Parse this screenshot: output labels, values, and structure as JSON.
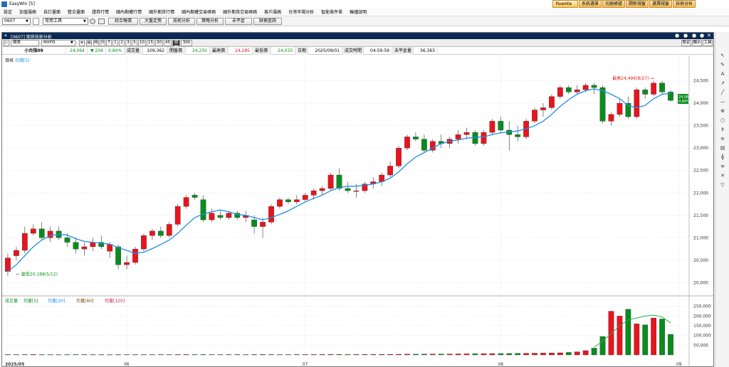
{
  "window": {
    "title": "EasyWin [5]"
  },
  "quickbar": {
    "logo": "Yuanta",
    "buttons": [
      "系統選單",
      "切換帳號",
      "開新視窗",
      "選擇視窗",
      "技術分析"
    ]
  },
  "menu": [
    "設定",
    "加值服務",
    "自訂畫面",
    "整合畫面",
    "證券行情",
    "國內期權行情",
    "國外期貨行情",
    "國內期權交易帳務",
    "國外期貨交易帳務",
    "客戶服務",
    "台灣市場分析",
    "智能條件單",
    "輪播說明"
  ],
  "toolbar": {
    "code": "0607",
    "dropdown": "常用工具",
    "buttons": [
      "綜合報價",
      "大盤走勢",
      "技術分析",
      "策略分析",
      "未平倉",
      "財務查詢"
    ]
  },
  "panel": {
    "title": "[0607] 期貨技術分析",
    "product": "期貨",
    "symbol": "MXFI5",
    "periods": [
      "時",
      "分",
      "T",
      "1",
      "2",
      "3",
      "5",
      "10",
      "15",
      "30",
      "45",
      "期間",
      "300"
    ],
    "right_buttons": [
      "設定",
      "顯示",
      "工具"
    ]
  },
  "info": {
    "name": "小台指09",
    "price": "24,064",
    "change": "204",
    "change_pct": "0.84%",
    "vol_label": "成交量",
    "vol": "109,362",
    "open_label": "開盤價",
    "open": "24,250",
    "high_label": "最高價",
    "high": "24,285",
    "low_label": "最低價",
    "low": "24,033",
    "date_label": "日期",
    "date": "2025/09/01",
    "time_label": "成交時間",
    "time": "04:59:59",
    "oi_label": "未平倉量",
    "oi": "36,363"
  },
  "colors": {
    "up": "#e8141e",
    "down": "#0a8c1e",
    "ma": "#1f8ee8"
  },
  "chart_data": {
    "type": "candlestick",
    "price_legend": {
      "label": "價格",
      "ma": "均價[5]"
    },
    "volume_legend": {
      "label": "成交量",
      "ma": [
        "均量[5]",
        "均量[20]",
        "均量[60]",
        "均量[120]"
      ]
    },
    "price_axis": {
      "min": 19800,
      "max": 24700,
      "ticks": [
        "24,500",
        "24,000",
        "23,500",
        "23,000",
        "22,500",
        "22,000",
        "21,500",
        "21,000",
        "20,500",
        "20,000"
      ]
    },
    "volume_axis": {
      "min": 0,
      "max": 260000,
      "ticks": [
        "250,000",
        "200,000",
        "150,000",
        "100,000",
        "50,000"
      ]
    },
    "x_labels": [
      {
        "i": 0,
        "text": "2025/05"
      },
      {
        "i": 14,
        "text": "06"
      },
      {
        "i": 35,
        "text": "07"
      },
      {
        "i": 58,
        "text": "08"
      },
      {
        "i": 79,
        "text": "09"
      }
    ],
    "annotations": {
      "high": {
        "i": 76,
        "text": "最高24,496(8/27)"
      },
      "low": {
        "i": 1,
        "text": "最低20,188(5/12)"
      }
    },
    "last_price_tag": {
      "price": "24,064",
      "pct": "0.84%"
    },
    "candles": [
      [
        20250,
        20650,
        20150,
        20550
      ],
      [
        20600,
        20800,
        20500,
        20720
      ],
      [
        20720,
        21250,
        20650,
        21100
      ],
      [
        21100,
        21300,
        21050,
        21200
      ],
      [
        21200,
        21350,
        20950,
        21000
      ],
      [
        21000,
        21250,
        20900,
        21150
      ],
      [
        21150,
        21250,
        20950,
        21000
      ],
      [
        21000,
        21100,
        20800,
        20900
      ],
      [
        20900,
        21000,
        20650,
        20750
      ],
      [
        20750,
        20900,
        20600,
        20800
      ],
      [
        20800,
        21000,
        20700,
        20900
      ],
      [
        20900,
        21050,
        20750,
        20800
      ],
      [
        20700,
        20900,
        20550,
        20850
      ],
      [
        20800,
        20850,
        20300,
        20400
      ],
      [
        20400,
        20600,
        20300,
        20450
      ],
      [
        20450,
        20800,
        20400,
        20750
      ],
      [
        20750,
        21100,
        20700,
        21050
      ],
      [
        21050,
        21200,
        20950,
        21150
      ],
      [
        21150,
        21250,
        21000,
        21050
      ],
      [
        21050,
        21350,
        21000,
        21300
      ],
      [
        21300,
        21750,
        21250,
        21700
      ],
      [
        21700,
        21950,
        21650,
        21900
      ],
      [
        21950,
        22000,
        21850,
        21900
      ],
      [
        21850,
        21950,
        21350,
        21400
      ],
      [
        21400,
        21650,
        21350,
        21550
      ],
      [
        21500,
        21600,
        21400,
        21450
      ],
      [
        21450,
        21600,
        21400,
        21550
      ],
      [
        21550,
        21600,
        21400,
        21450
      ],
      [
        21450,
        21600,
        21350,
        21500
      ],
      [
        21400,
        21500,
        21100,
        21250
      ],
      [
        21250,
        21450,
        21000,
        21350
      ],
      [
        21350,
        21750,
        21300,
        21700
      ],
      [
        21700,
        21900,
        21650,
        21850
      ],
      [
        21850,
        21900,
        21750,
        21800
      ],
      [
        21800,
        21950,
        21750,
        21850
      ],
      [
        21850,
        22000,
        21800,
        21950
      ],
      [
        21950,
        22100,
        21850,
        22050
      ],
      [
        22050,
        22150,
        21950,
        22100
      ],
      [
        22100,
        22450,
        22050,
        22400
      ],
      [
        22400,
        22550,
        22050,
        22100
      ],
      [
        22100,
        22250,
        22000,
        22050
      ],
      [
        22050,
        22200,
        21900,
        22050
      ],
      [
        22050,
        22250,
        22000,
        22200
      ],
      [
        22200,
        22350,
        22100,
        22250
      ],
      [
        22250,
        22450,
        22150,
        22400
      ],
      [
        22400,
        22700,
        22350,
        22600
      ],
      [
        22600,
        23050,
        22550,
        23000
      ],
      [
        23000,
        23300,
        22950,
        23250
      ],
      [
        23250,
        23350,
        23150,
        23200
      ],
      [
        23200,
        23300,
        22900,
        22950
      ],
      [
        22950,
        23200,
        22900,
        23150
      ],
      [
        23150,
        23300,
        23000,
        23100
      ],
      [
        23100,
        23250,
        23000,
        23200
      ],
      [
        23200,
        23400,
        23100,
        23300
      ],
      [
        23300,
        23450,
        23200,
        23350
      ],
      [
        23350,
        23400,
        23050,
        23100
      ],
      [
        23100,
        23400,
        23050,
        23350
      ],
      [
        23350,
        23650,
        23300,
        23600
      ],
      [
        23600,
        23700,
        23350,
        23400
      ],
      [
        23400,
        23600,
        22950,
        23300
      ],
      [
        23300,
        23500,
        23150,
        23250
      ],
      [
        23250,
        23650,
        23200,
        23600
      ],
      [
        23600,
        23900,
        23550,
        23850
      ],
      [
        23850,
        24000,
        23700,
        23900
      ],
      [
        23900,
        24200,
        23850,
        24150
      ],
      [
        24150,
        24400,
        24100,
        24350
      ],
      [
        24350,
        24400,
        24200,
        24250
      ],
      [
        24250,
        24400,
        24200,
        24300
      ],
      [
        24300,
        24450,
        24250,
        24400
      ],
      [
        24400,
        24450,
        24200,
        24350
      ],
      [
        24350,
        24400,
        23550,
        23600
      ],
      [
        23600,
        23800,
        23500,
        23750
      ],
      [
        23750,
        24100,
        23700,
        24000
      ],
      [
        24000,
        24150,
        23650,
        23700
      ],
      [
        23700,
        24350,
        23650,
        24300
      ],
      [
        24300,
        24350,
        24100,
        24200
      ],
      [
        24200,
        24496,
        24150,
        24450
      ],
      [
        24450,
        24500,
        24200,
        24250
      ],
      [
        24250,
        24285,
        24033,
        24064
      ]
    ],
    "volumes": [
      2000,
      1800,
      1900,
      2200,
      1700,
      1800,
      1600,
      1700,
      1900,
      1800,
      1700,
      1800,
      1600,
      1900,
      1800,
      1700,
      1800,
      1900,
      2000,
      1800,
      2100,
      2200,
      1900,
      2000,
      1800,
      1700,
      1900,
      2000,
      1800,
      2100,
      2200,
      2000,
      1900,
      1800,
      2100,
      2000,
      2200,
      2300,
      2500,
      2400,
      2200,
      2300,
      2600,
      2700,
      2800,
      3000,
      3500,
      4000,
      3800,
      4200,
      4500,
      4800,
      5000,
      5500,
      5800,
      6000,
      6500,
      7000,
      7200,
      7500,
      8000,
      8500,
      9000,
      9500,
      10000,
      11000,
      13000,
      16000,
      22000,
      35000,
      95000,
      225000,
      200000,
      235000,
      160000,
      155000,
      190000,
      185000,
      106000
    ],
    "ma5": [
      20250,
      20400,
      20600,
      20800,
      20950,
      21050,
      21080,
      21060,
      20980,
      20920,
      20900,
      20880,
      20860,
      20780,
      20720,
      20650,
      20680,
      20760,
      20850,
      20950,
      21100,
      21280,
      21450,
      21530,
      21580,
      21620,
      21580,
      21520,
      21500,
      21450,
      21400,
      21450,
      21520,
      21600,
      21700,
      21800,
      21880,
      21950,
      22050,
      22120,
      22150,
      22150,
      22170,
      22200,
      22250,
      22330,
      22470,
      22650,
      22800,
      22900,
      23000,
      23100,
      23150,
      23180,
      23220,
      23240,
      23250,
      23300,
      23340,
      23360,
      23380,
      23430,
      23500,
      23600,
      23750,
      23930,
      24080,
      24200,
      24280,
      24320,
      24280,
      24200,
      24100,
      23950,
      23900,
      23950,
      24100,
      24200,
      24220
    ],
    "vma": [
      null,
      null,
      null,
      null,
      null,
      null,
      null,
      null,
      null,
      null,
      null,
      null,
      null,
      null,
      null,
      null,
      null,
      null,
      null,
      null,
      null,
      null,
      null,
      null,
      null,
      null,
      null,
      null,
      null,
      null,
      null,
      null,
      null,
      null,
      null,
      null,
      null,
      null,
      null,
      null,
      null,
      null,
      null,
      null,
      null,
      null,
      null,
      null,
      null,
      null,
      null,
      null,
      null,
      null,
      null,
      null,
      null,
      null,
      null,
      null,
      null,
      null,
      null,
      null,
      null,
      null,
      null,
      null,
      null,
      40000,
      70000,
      110000,
      150000,
      180000,
      190000,
      200000,
      205000,
      195000,
      165000
    ]
  }
}
